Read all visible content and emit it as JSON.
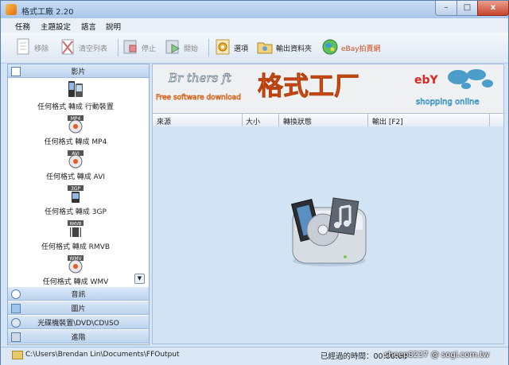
{
  "window": {
    "title": "格式工廠 2.20",
    "min": "–",
    "max": "□",
    "close": "x"
  },
  "menu": [
    "任務",
    "主題設定",
    "語言",
    "說明"
  ],
  "toolbar": {
    "remove": "移除",
    "clear_list": "清空列表",
    "stop": "停止",
    "start": "開始",
    "options": "選項",
    "output_folder": "輸出資料夾",
    "ebay": "eBay拍賣網"
  },
  "sidebar": {
    "video_category": "影片",
    "items": [
      "任何格式 轉成 行動裝置",
      "任何格式 轉成 MP4",
      "任何格式 轉成 AVI",
      "任何格式 轉成 3GP",
      "任何格式 轉成 RMVB",
      "任何格式 轉成 WMV"
    ],
    "icon_tags": [
      "",
      "MP4",
      "AVI",
      "3GP",
      "RMVB",
      "WMV"
    ],
    "categories": [
      "音訊",
      "圖片",
      "光碟機裝置\\DVD\\CD\\ISO",
      "進階"
    ]
  },
  "banner": {
    "brand": "Br thers ft",
    "brand_sub": "Free software download",
    "title": "格式工厂",
    "ebay": "ebY",
    "ebay_sub": "shopping online"
  },
  "table": {
    "columns": [
      "來源",
      "大小",
      "轉換狀態",
      "輸出 [F2]"
    ]
  },
  "status": {
    "output_path": "C:\\Users\\Brendan Lin\\Documents\\FFOutput",
    "elapsed": "已經過的時間：00:00:00",
    "watermark": "sheep8237 @ sogi.com.tw"
  },
  "colors": {
    "accent": "#d8501a",
    "banner_title": "#e25a1c",
    "window_bg": "#d6e5f5"
  }
}
